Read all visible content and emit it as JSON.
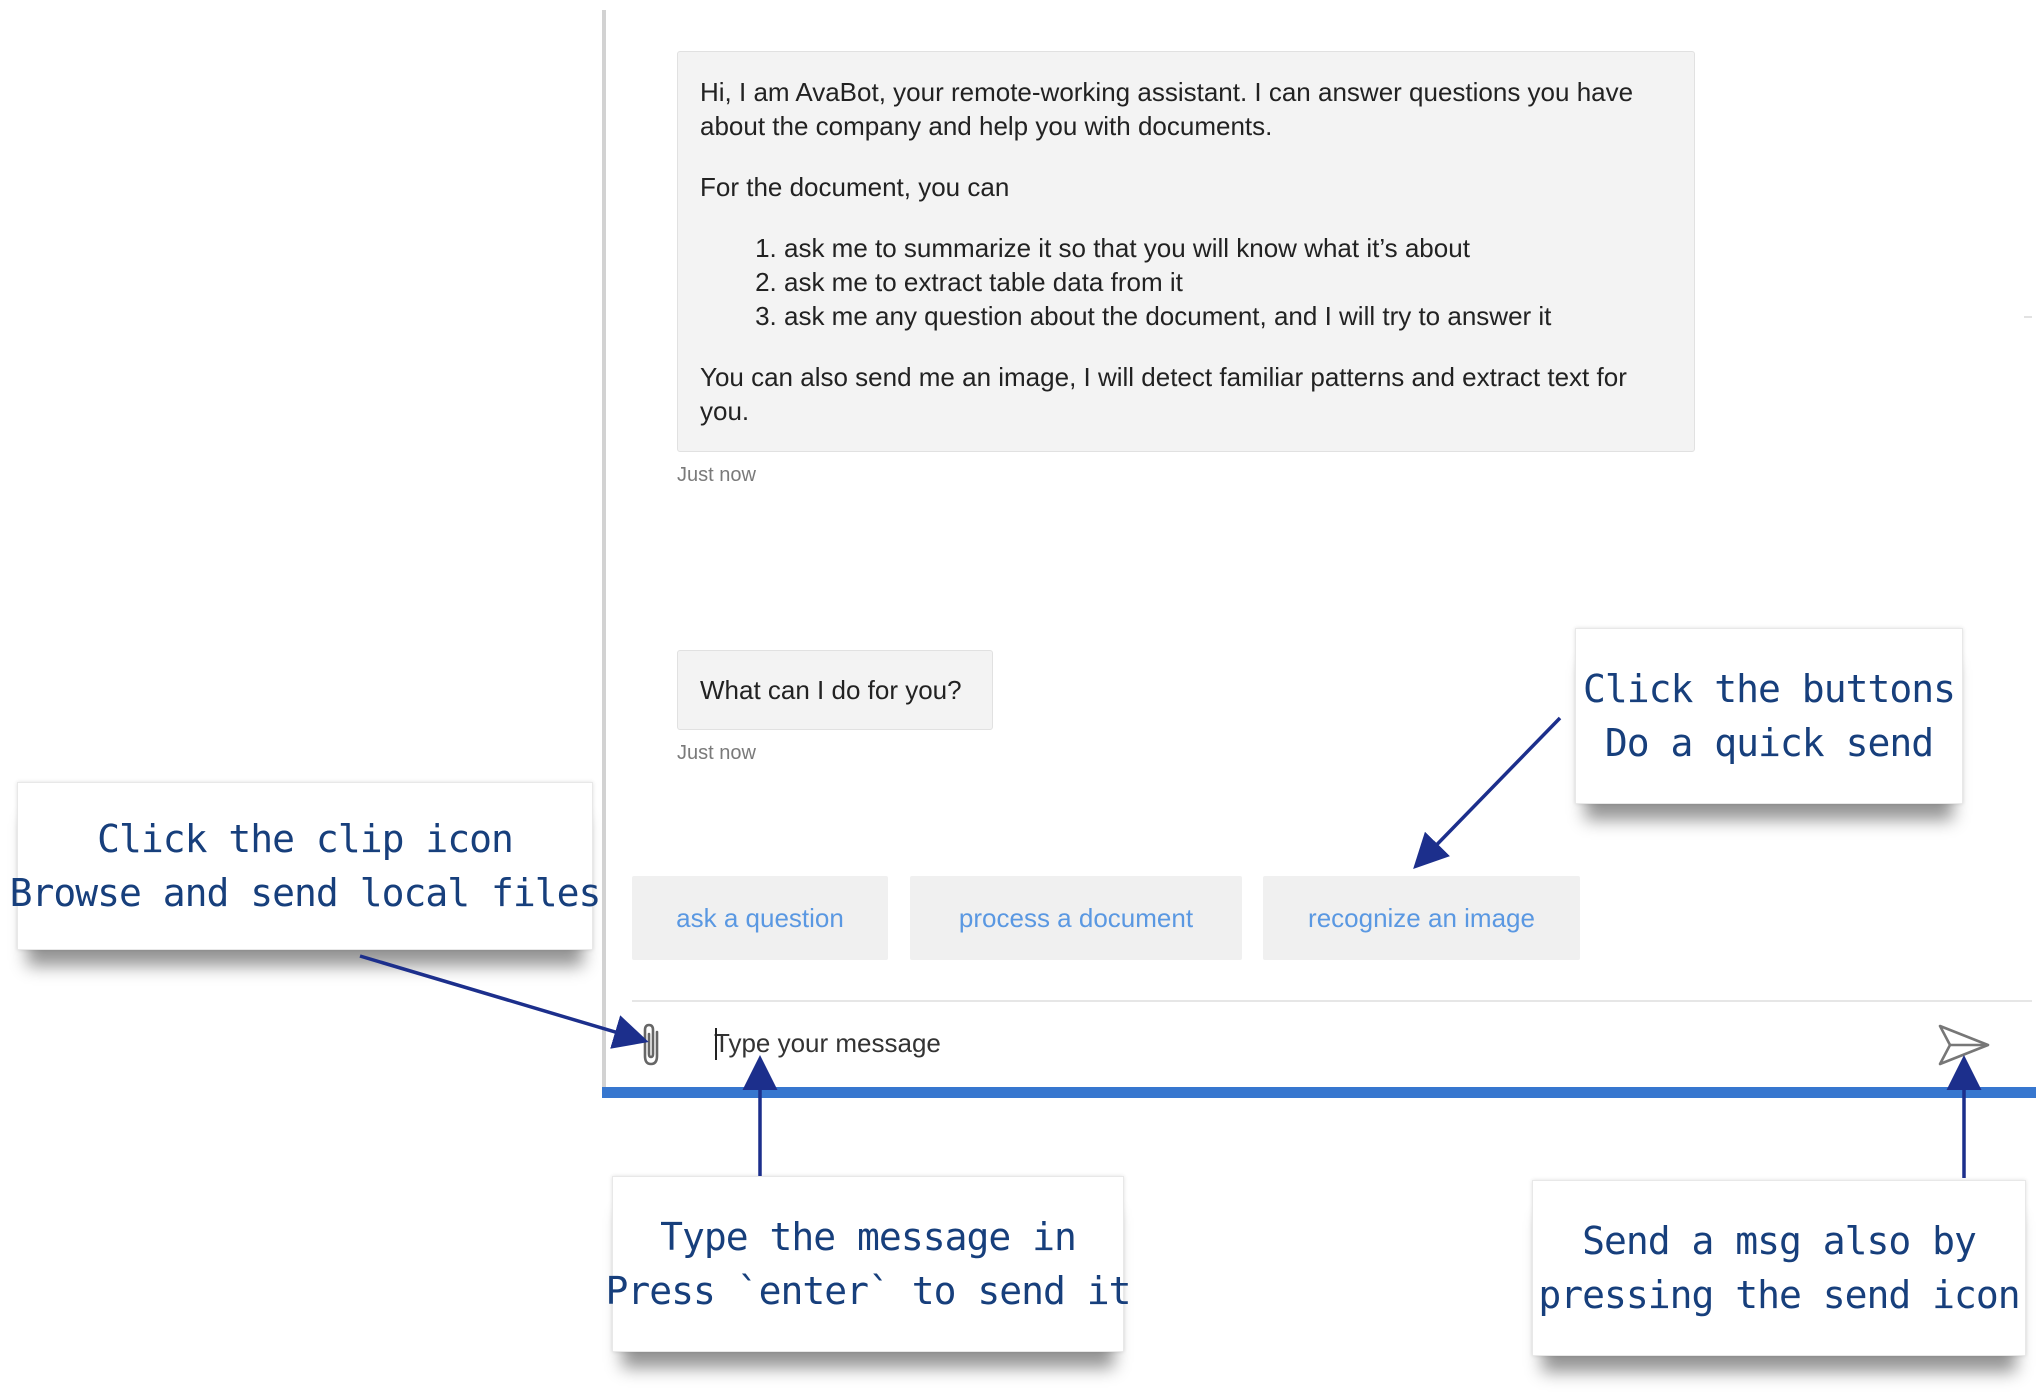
{
  "chat": {
    "welcome": {
      "intro": "Hi, I am AvaBot, your remote-working assistant. I can answer questions you have about the company and help you with documents.",
      "doc_heading": "For the document, you can",
      "options": [
        "ask me to summarize it so that you will know what it’s about",
        "ask me to extract table data from it",
        "ask me any question about the document, and I will try to answer it"
      ],
      "image_note": "You can also send me an image, I will detect familiar patterns and extract text for you.",
      "timestamp": "Just now"
    },
    "question": {
      "text": "What can I do for you?",
      "timestamp": "Just now"
    },
    "quick_replies": [
      {
        "label": "ask a question"
      },
      {
        "label": "process a document"
      },
      {
        "label": "recognize an image"
      }
    ],
    "input": {
      "placeholder": "Type your message",
      "value": ""
    },
    "icons": {
      "attach": "paperclip-icon",
      "send": "paper-plane-send-icon"
    },
    "colors": {
      "accent_bar": "#3777cf",
      "quick_reply_text": "#5a98e2",
      "bubble_bg": "#f3f3f3"
    }
  },
  "annotations": {
    "clip": [
      "Click the clip icon",
      "Browse and send local files"
    ],
    "buttons": [
      "Click the buttons",
      "Do a quick send"
    ],
    "type": [
      "Type the message in",
      "Press `enter` to send it"
    ],
    "send": [
      "Send a msg also by",
      "pressing the send icon"
    ],
    "text_color": "#173f7c"
  }
}
